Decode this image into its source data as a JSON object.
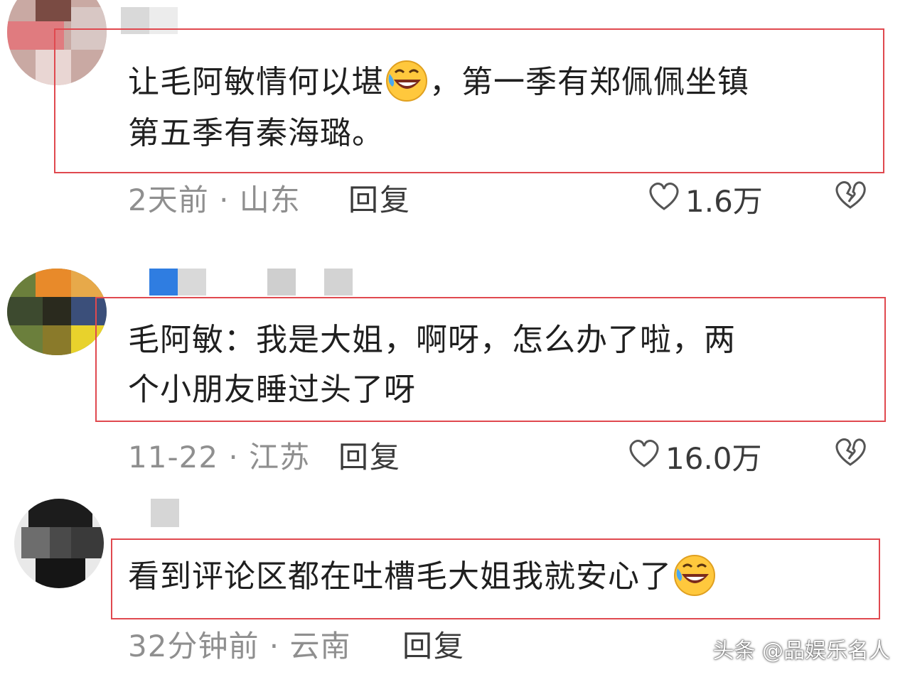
{
  "comments": [
    {
      "lines": [
        "让毛阿敏情何以堪",
        "，第一季有郑佩佩坐镇",
        "第五季有秦海璐。"
      ],
      "time": "2天前 · 山东",
      "reply": "回复",
      "likes": "1.6万"
    },
    {
      "lines": [
        "毛阿敏：我是大姐，啊呀，怎么办了啦，两",
        "个小朋友睡过头了呀"
      ],
      "time": "11-22 · 江苏",
      "reply": "回复",
      "likes": "16.0万"
    },
    {
      "lines": [
        "看到评论区都在吐槽毛大姐我就安心了"
      ],
      "time": "32分钟前 · 云南",
      "reply": "回复"
    }
  ],
  "watermark": "头条 @品娱乐名人",
  "colors": {
    "highlight": "#e0494f",
    "meta": "#8f8f8f",
    "text": "#1f1f1f"
  },
  "icons": [
    "laughing-crying-emoji",
    "heart-icon",
    "broken-heart-icon"
  ]
}
